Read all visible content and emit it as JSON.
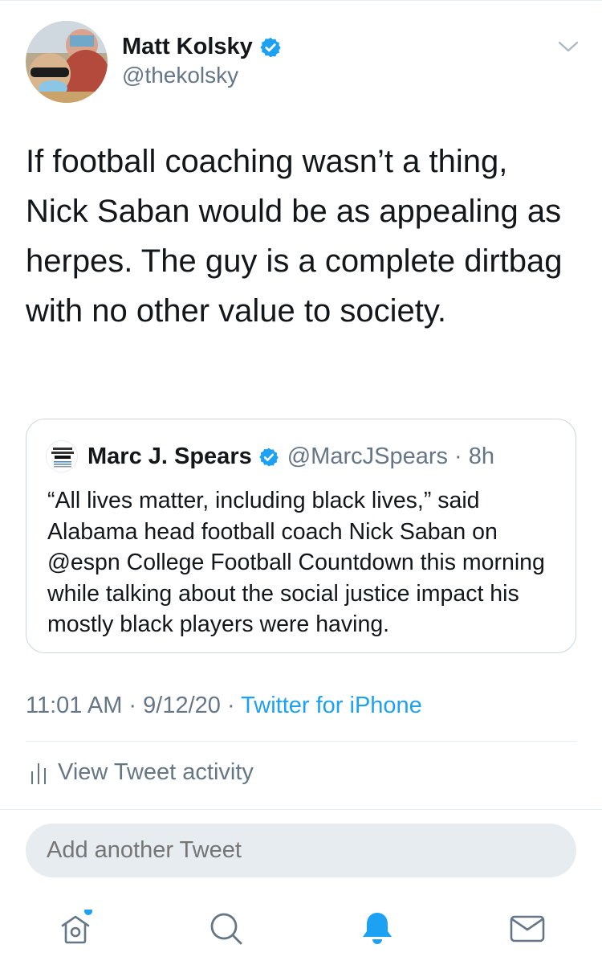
{
  "tweet": {
    "author": {
      "name": "Matt Kolsky",
      "handle": "@thekolsky",
      "verified": true
    },
    "text": "If football coaching wasn’t a thing, Nick Saban would be as appealing as herpes. The guy is a complete dirtbag with no other value to society.",
    "quoted": {
      "author": {
        "name": "Marc J. Spears",
        "handle": "@MarcJSpears · 8h",
        "verified": true
      },
      "text": "“All lives matter, including black lives,” said Alabama head football coach Nick Saban on @espn College Football Countdown this morning while talking about the social justice impact his mostly black players were having."
    },
    "timestamp": "11:01 AM · 9/12/20 · ",
    "source": "Twitter for iPhone",
    "activity_label": "View Tweet activity"
  },
  "composer": {
    "placeholder": "Add another Tweet"
  },
  "tabbar": {
    "icons": [
      "home-icon",
      "search-icon",
      "notifications-icon",
      "messages-icon"
    ],
    "home_has_badge": true
  },
  "colors": {
    "accent": "#1da1f2",
    "text": "#14171a",
    "secondary_text": "#657786",
    "divider": "#e6ecf0"
  }
}
